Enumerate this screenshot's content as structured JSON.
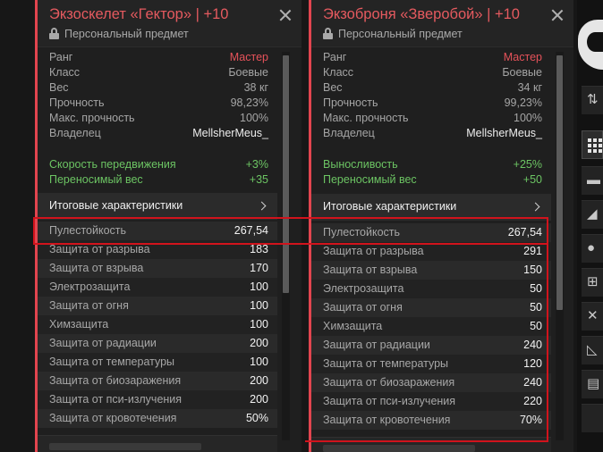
{
  "cards": [
    {
      "title": "Экзоскелет «Гектор» | +10",
      "subtitle": "Персональный предмет",
      "info": [
        {
          "key": "Ранг",
          "value": "Мастер"
        },
        {
          "key": "Класс",
          "value": "Боевые"
        },
        {
          "key": "Вес",
          "value": "38 кг"
        },
        {
          "key": "Прочность",
          "value": "98,23%"
        },
        {
          "key": "Макс. прочность",
          "value": "100%"
        },
        {
          "key": "Владелец",
          "value": "MellsherMeus_"
        }
      ],
      "bonuses": [
        {
          "key": "Скорость передвижения",
          "value": "+3%"
        },
        {
          "key": "Переносимый вес",
          "value": "+35"
        }
      ],
      "totals_label": "Итоговые характеристики",
      "stats": [
        {
          "key": "Пулестойкость",
          "value": "267,54"
        },
        {
          "key": "Защита от разрыва",
          "value": "183"
        },
        {
          "key": "Защита от взрыва",
          "value": "170"
        },
        {
          "key": "Электрозащита",
          "value": "100"
        },
        {
          "key": "Защита от огня",
          "value": "100"
        },
        {
          "key": "Химзащита",
          "value": "100"
        },
        {
          "key": "Защита от радиации",
          "value": "200"
        },
        {
          "key": "Защита от температуры",
          "value": "100"
        },
        {
          "key": "Защита от биозаражения",
          "value": "200"
        },
        {
          "key": "Защита от пси-излучения",
          "value": "200"
        },
        {
          "key": "Защита от кровотечения",
          "value": "50%"
        }
      ]
    },
    {
      "title": "Экзоброня «Зверобой» | +10",
      "subtitle": "Персональный предмет",
      "info": [
        {
          "key": "Ранг",
          "value": "Мастер"
        },
        {
          "key": "Класс",
          "value": "Боевые"
        },
        {
          "key": "Вес",
          "value": "34 кг"
        },
        {
          "key": "Прочность",
          "value": "99,23%"
        },
        {
          "key": "Макс. прочность",
          "value": "100%"
        },
        {
          "key": "Владелец",
          "value": "MellsherMeus_"
        }
      ],
      "bonuses": [
        {
          "key": "Выносливость",
          "value": "+25%"
        },
        {
          "key": "Переносимый вес",
          "value": "+50"
        }
      ],
      "totals_label": "Итоговые характеристики",
      "stats": [
        {
          "key": "Пулестойкость",
          "value": "267,54"
        },
        {
          "key": "Защита от разрыва",
          "value": "291"
        },
        {
          "key": "Защита от взрыва",
          "value": "150"
        },
        {
          "key": "Электрозащита",
          "value": "50"
        },
        {
          "key": "Защита от огня",
          "value": "50"
        },
        {
          "key": "Химзащита",
          "value": "50"
        },
        {
          "key": "Защита от радиации",
          "value": "240"
        },
        {
          "key": "Защита от температуры",
          "value": "120"
        },
        {
          "key": "Защита от биозаражения",
          "value": "240"
        },
        {
          "key": "Защита от пси-излучения",
          "value": "220"
        },
        {
          "key": "Защита от кровотечения",
          "value": "70%"
        }
      ]
    }
  ],
  "colors": {
    "accent": "#e2454f",
    "rank": "#e5525a",
    "bonus_green": "#6cc463",
    "highlight": "#d1131c"
  }
}
